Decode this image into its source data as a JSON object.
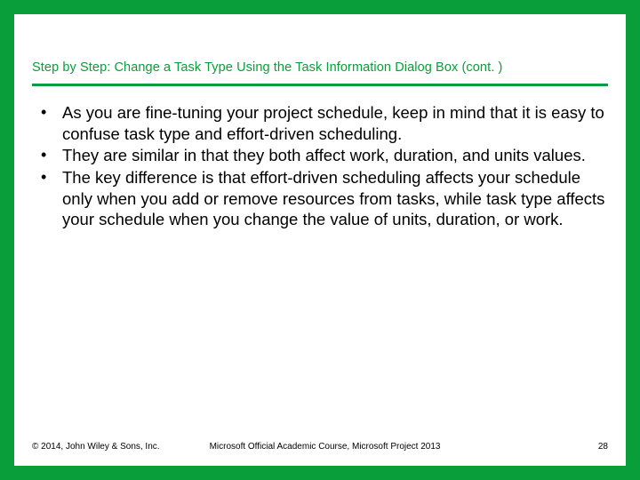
{
  "slide": {
    "title": "Step by Step: Change a Task Type Using the Task Information Dialog Box (cont. )",
    "bullets": [
      "As you are fine-tuning your project schedule, keep in mind that it is easy to confuse task type and effort-driven scheduling.",
      "They are similar in that they both affect work, duration, and units values.",
      "The key difference is that effort-driven scheduling affects your schedule only when you add or remove resources from tasks, while task type affects your schedule when you change the value of units, duration, or work."
    ]
  },
  "footer": {
    "copyright": "© 2014, John Wiley & Sons, Inc.",
    "course": "Microsoft Official Academic Course, Microsoft Project 2013",
    "page": "28"
  }
}
